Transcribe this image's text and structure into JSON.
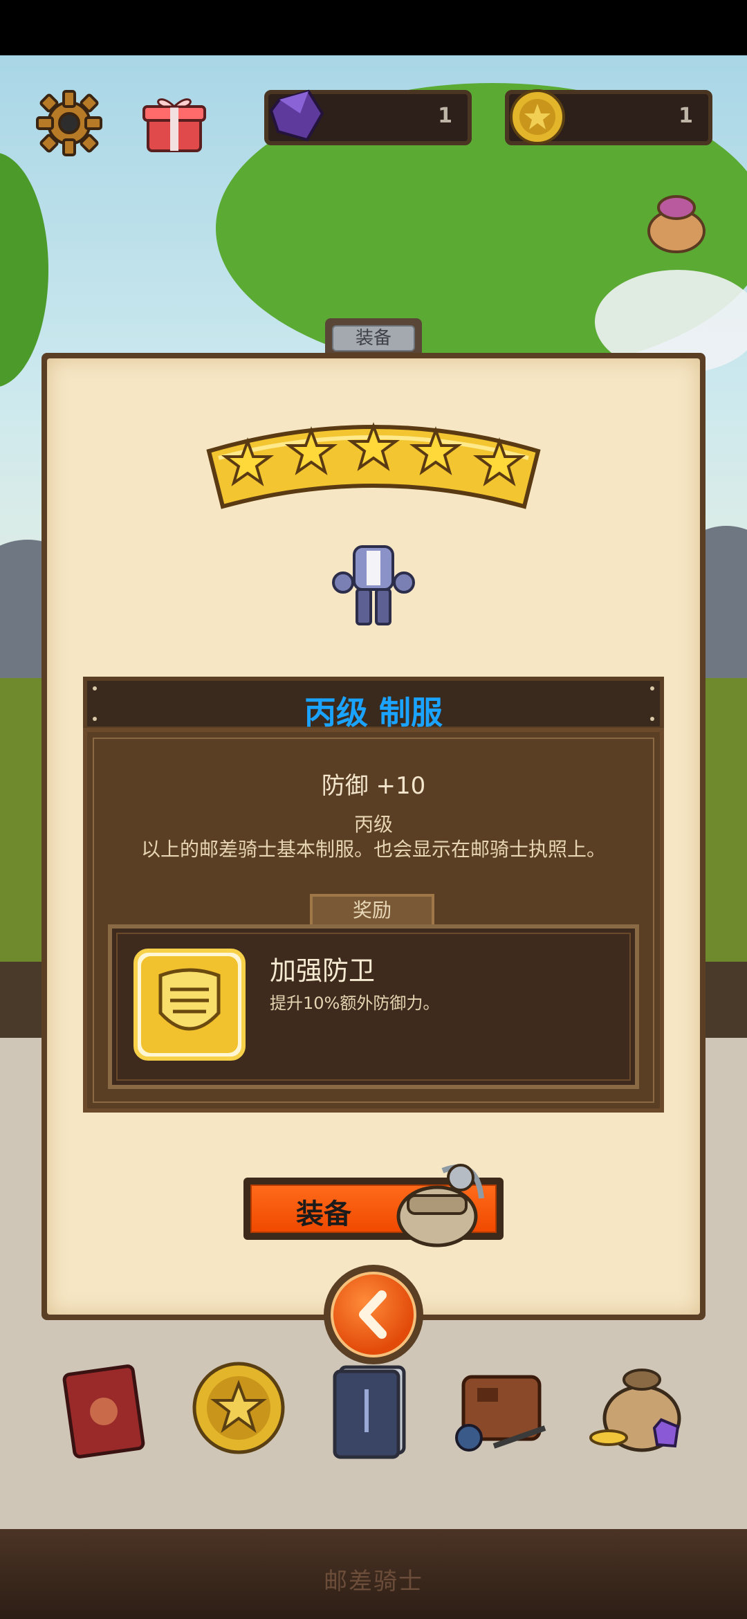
{
  "hud": {
    "gems": "1",
    "coins": "1"
  },
  "panel": {
    "tab_label": "装备",
    "stars": 5,
    "item_title": "丙级 制服",
    "stat": "防御 +10",
    "grade": "丙级",
    "description": "以上的邮差骑士基本制服。也会显示在邮骑士执照上。",
    "reward_tab_label": "奖励",
    "reward_name": "加强防卫",
    "reward_desc": "提升10%额外防御力。",
    "equip_button": "装备"
  },
  "nav": {
    "items": [
      "book-icon",
      "star-coin-icon",
      "card-deck-icon",
      "satchel-icon",
      "treasure-bag-icon"
    ]
  },
  "footer": {
    "title": "邮差骑士"
  },
  "colors": {
    "title_blue": "#1aa3ff",
    "button_orange": "#f04a00",
    "parchment": "#f6e6c4",
    "wood_dark": "#5a3f25"
  }
}
